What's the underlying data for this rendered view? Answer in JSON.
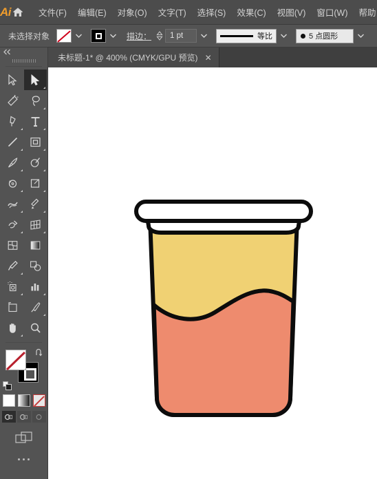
{
  "app": {
    "name": "Adobe Illustrator",
    "logo_text": "Ai",
    "home_icon": "home-icon"
  },
  "menubar": {
    "items": [
      {
        "label": "文件(F)"
      },
      {
        "label": "编辑(E)"
      },
      {
        "label": "对象(O)"
      },
      {
        "label": "文字(T)"
      },
      {
        "label": "选择(S)"
      },
      {
        "label": "效果(C)"
      },
      {
        "label": "视图(V)"
      },
      {
        "label": "窗口(W)"
      },
      {
        "label": "帮助"
      }
    ]
  },
  "controlbar": {
    "selection_status": "未选择对象",
    "fill_swatch": "none",
    "stroke_swatch": "black",
    "stroke_label": "描边：",
    "stroke_weight": "1 pt",
    "stroke_profile": "等比",
    "brush_definition": "5 点圆形",
    "brush_icon": "round-dot-icon"
  },
  "tabbar": {
    "tab_title": "未标题-1* @ 400% (CMYK/GPU 预览)",
    "close_label": "✕"
  },
  "toolbar": {
    "collapse_icon": "double-chevron-left-icon",
    "tools": [
      {
        "name": "selection-tool",
        "selected": false
      },
      {
        "name": "direct-selection-tool",
        "selected": true
      },
      {
        "name": "magic-wand-tool",
        "selected": false
      },
      {
        "name": "lasso-tool",
        "selected": false
      },
      {
        "name": "pen-tool",
        "selected": false
      },
      {
        "name": "type-tool",
        "selected": false
      },
      {
        "name": "line-segment-tool",
        "selected": false
      },
      {
        "name": "rectangle-tool",
        "selected": false
      },
      {
        "name": "paintbrush-tool",
        "selected": false
      },
      {
        "name": "shaper-tool",
        "selected": false
      },
      {
        "name": "rotate-tool",
        "selected": false
      },
      {
        "name": "shape-builder-tool",
        "selected": false
      },
      {
        "name": "reflect-tool",
        "selected": false
      },
      {
        "name": "scale-tool",
        "selected": false
      },
      {
        "name": "width-tool",
        "selected": false
      },
      {
        "name": "free-transform-tool",
        "selected": false
      },
      {
        "name": "warp-tool",
        "selected": false
      },
      {
        "name": "perspective-grid-tool",
        "selected": false
      },
      {
        "name": "mesh-tool",
        "selected": false
      },
      {
        "name": "gradient-tool",
        "selected": false
      },
      {
        "name": "eyedropper-tool",
        "selected": false
      },
      {
        "name": "blend-tool",
        "selected": false
      },
      {
        "name": "symbol-sprayer-tool",
        "selected": false
      },
      {
        "name": "column-graph-tool",
        "selected": false
      },
      {
        "name": "artboard-tool",
        "selected": false
      },
      {
        "name": "slice-tool",
        "selected": false
      },
      {
        "name": "hand-tool",
        "selected": false
      },
      {
        "name": "zoom-tool",
        "selected": false
      }
    ],
    "fill_state": "none",
    "stroke_state": "black",
    "swap_icon": "swap-fill-stroke-icon",
    "default_icon": "default-fill-stroke-icon",
    "paint_modes": [
      "color",
      "gradient",
      "none"
    ],
    "paint_mode_active": "none",
    "draw_modes": [
      "draw-normal",
      "draw-behind",
      "draw-inside"
    ],
    "draw_mode_active": "draw-normal",
    "screen_mode_icon": "change-screen-mode-icon",
    "more_icon": "edit-toolbar-icon"
  },
  "artwork": {
    "description": "插图：带盖杯子，上半部黄色，下半部粉橙色液体",
    "colors": {
      "rim": "#ffffff",
      "upper_body": "#f0d173",
      "liquid": "#ee8b6e",
      "outline": "#0c0c0c"
    },
    "zoom_level": "400%"
  }
}
